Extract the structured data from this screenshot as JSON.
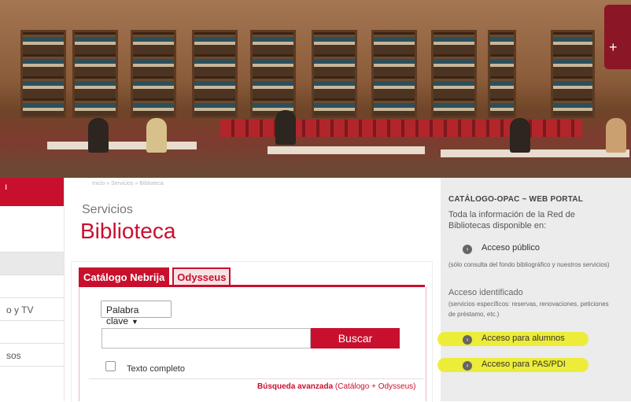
{
  "banner": {
    "logo_text": "+"
  },
  "sidebar": {
    "items": [
      "",
      "",
      "",
      "o y TV",
      "",
      "sos"
    ]
  },
  "breadcrumb": "Inicio  »  Servicios  »  Biblioteca",
  "page": {
    "section": "Servicios",
    "title": "Biblioteca"
  },
  "tabs": [
    {
      "label": "Catálogo Nebrija",
      "active": true
    },
    {
      "label": "Odysseus",
      "active": false
    }
  ],
  "search": {
    "select_value": "Palabra clave",
    "input_value": "",
    "button_label": "Buscar",
    "fulltext_label": "Texto completo",
    "advanced_label": "Búsqueda avanzada",
    "advanced_suffix": " (Catálogo + Odysseus)"
  },
  "right": {
    "title": "CATÁLOGO-OPAC ~ WEB PORTAL",
    "description": "Toda la información de la Red de Bibliotecas disponible en:",
    "public_link": "Acceso público",
    "public_note": "(sólo consulta del fondo bibliográfico y nuestros servicios)",
    "identified_title": "Acceso identificado",
    "identified_note": "(servicios específicos: reservas, renovaciones, peticiones de préstamo, etc.)",
    "students_link": "Acceso para alumnos",
    "staff_link": "Acceso para PAS/PDI",
    "link_icon": "›"
  },
  "colors": {
    "accent": "#c8102e",
    "highlight": "#ecec1a"
  }
}
